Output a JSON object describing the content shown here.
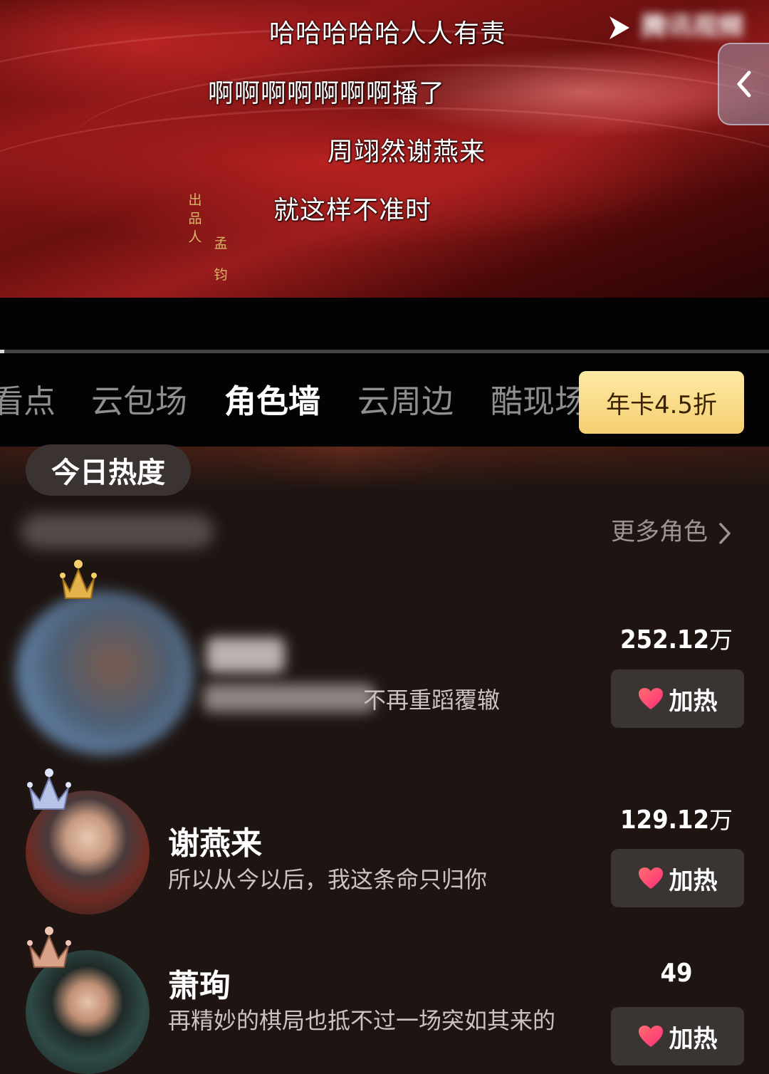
{
  "video": {
    "danmaku": [
      "哈哈哈哈哈人人有责",
      "啊啊啊啊啊啊啊播了",
      "周翊然谢燕来",
      "就这样不准时"
    ],
    "credit_role": "出品人",
    "credit_name": "孟钧",
    "top_logo": "腾讯视频",
    "collapse_icon": "chevron-left-icon",
    "progress": 0.003
  },
  "tabs": {
    "items": [
      "看点",
      "云包场",
      "角色墙",
      "云周边",
      "酷现场"
    ],
    "active": "角色墙",
    "promo_label": "年卡4.5折"
  },
  "heat_section": {
    "badge": "今日热度",
    "more_label": "更多角色",
    "more_icon": "chevron-right-icon"
  },
  "characters": [
    {
      "rank": 1,
      "crown": "gold",
      "name": "",
      "quote": "不再重蹈覆辙",
      "score": "252.12",
      "unit": "万",
      "button_label": "加热",
      "blurred": true
    },
    {
      "rank": 2,
      "crown": "silver",
      "name": "谢燕来",
      "quote": "所以从今以后，我这条命只归你",
      "score": "129.12",
      "unit": "万",
      "button_label": "加热",
      "blurred": false
    },
    {
      "rank": 3,
      "crown": "bronze",
      "name": "萧珣",
      "quote": "再精妙的棋局也抵不过一场突如其来的",
      "score": "49",
      "unit": "",
      "button_label": "加热",
      "blurred": false
    }
  ],
  "colors": {
    "accent_pink": "#ff3c6a",
    "promo_gold": "#f6cf70",
    "crown_gold": "#e3b24a",
    "crown_silver": "#b8c3e8",
    "crown_bronze": "#d9a38a"
  }
}
